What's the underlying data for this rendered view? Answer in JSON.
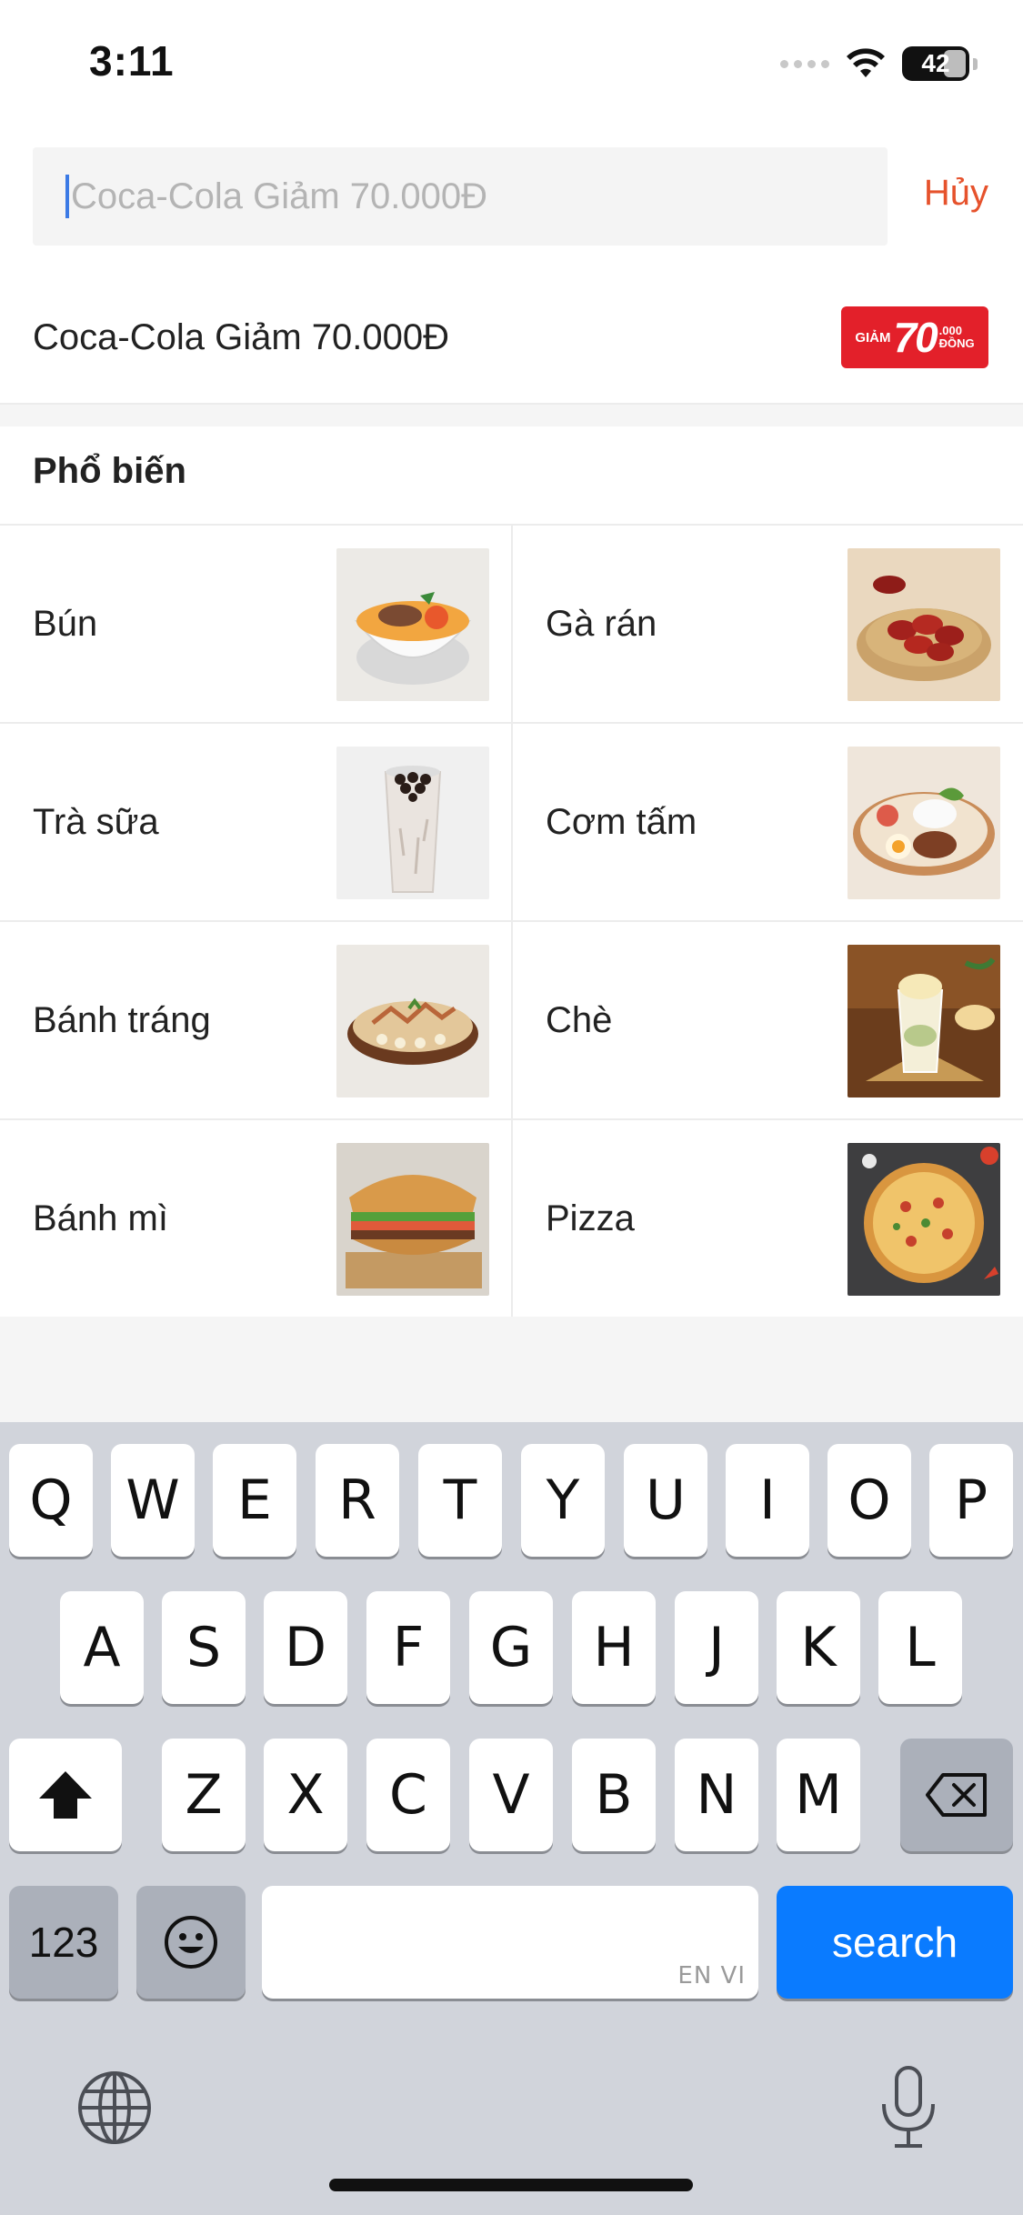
{
  "status_bar": {
    "time": "3:11",
    "battery": "42"
  },
  "search": {
    "placeholder": "Coca-Cola Giảm 70.000Đ",
    "cancel_label": "Hủy"
  },
  "suggestion": {
    "text": "Coca-Cola Giảm 70.000Đ",
    "badge": {
      "prefix": "GIẢM",
      "amount": "70",
      "suffix_top": ".000",
      "suffix_bottom": "ĐỒNG"
    }
  },
  "popular": {
    "title": "Phổ biến",
    "items": [
      {
        "label": "Bún",
        "icon": "noodle-bowl-image"
      },
      {
        "label": "Gà rán",
        "icon": "fried-chicken-image"
      },
      {
        "label": "Trà sữa",
        "icon": "milk-tea-image"
      },
      {
        "label": "Cơm tấm",
        "icon": "broken-rice-image"
      },
      {
        "label": "Bánh tráng",
        "icon": "rice-paper-image"
      },
      {
        "label": "Chè",
        "icon": "che-dessert-image"
      },
      {
        "label": "Bánh mì",
        "icon": "banh-mi-image"
      },
      {
        "label": "Pizza",
        "icon": "pizza-image"
      }
    ]
  },
  "keyboard": {
    "row1": [
      "Q",
      "W",
      "E",
      "R",
      "T",
      "Y",
      "U",
      "I",
      "O",
      "P"
    ],
    "row2": [
      "A",
      "S",
      "D",
      "F",
      "G",
      "H",
      "J",
      "K",
      "L"
    ],
    "row3": [
      "Z",
      "X",
      "C",
      "V",
      "B",
      "N",
      "M"
    ],
    "numbers_label": "123",
    "space_hint": "EN VI",
    "action_label": "search"
  }
}
